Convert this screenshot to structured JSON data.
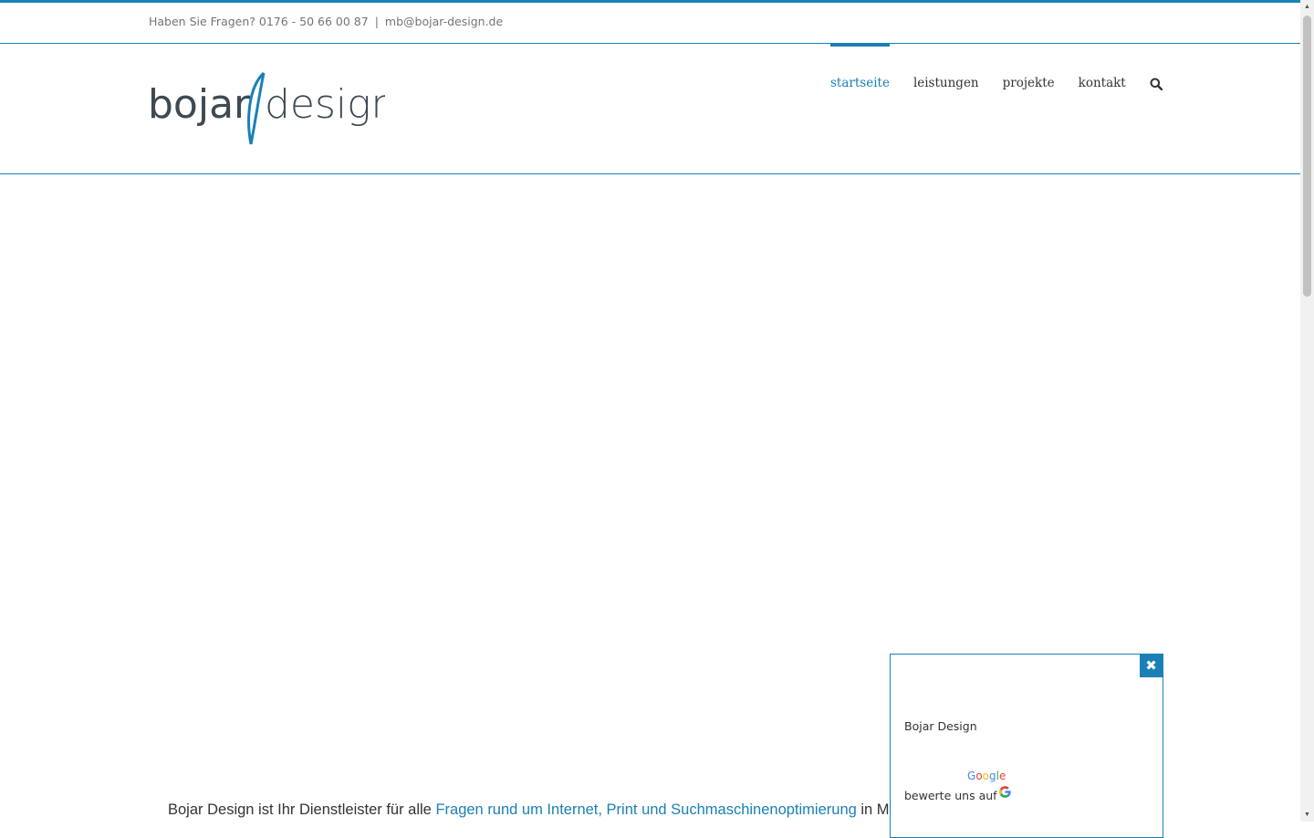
{
  "topbar": {
    "question": "Haben Sie Fragen? 0176 - 50 66 00 87",
    "separator": "|",
    "email": "mb@bojar-design.de"
  },
  "logo": {
    "word1": "bojar",
    "word2": "design"
  },
  "nav": {
    "items": [
      {
        "label": "startseite",
        "active": true
      },
      {
        "label": "leistungen",
        "active": false
      },
      {
        "label": "projekte",
        "active": false
      },
      {
        "label": "kontakt",
        "active": false
      }
    ],
    "search_icon": "search-icon"
  },
  "intro": {
    "prefix": "Bojar Design ist Ihr Dienstleister für alle ",
    "link": "Fragen rund um Internet, Print und Suchmaschinenoptimierung",
    "suffix": " in M"
  },
  "review_popup": {
    "close_symbol": "✖",
    "business_name": "Bojar Design",
    "google_word": "Google",
    "rate_text": "bewerte uns auf",
    "google_icon": "google-g-icon"
  },
  "colors": {
    "accent": "#1a80b6",
    "text": "#333333",
    "muted": "#747474",
    "logo_gray": "#3d4a52"
  }
}
